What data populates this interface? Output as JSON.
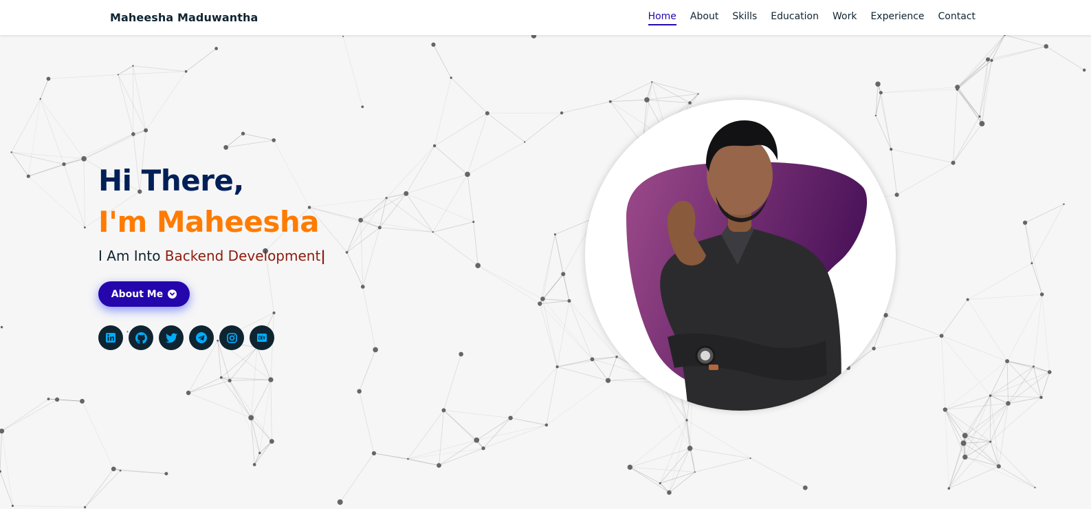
{
  "brand": "Maheesha Maduwantha",
  "nav": [
    {
      "label": "Home",
      "active": true
    },
    {
      "label": "About"
    },
    {
      "label": "Skills"
    },
    {
      "label": "Education"
    },
    {
      "label": "Work"
    },
    {
      "label": "Experience"
    },
    {
      "label": "Contact"
    }
  ],
  "hero": {
    "greeting": "Hi There,",
    "name": "I'm Maheesha",
    "role_prefix": "I Am Into",
    "role_typed": "Backend Development",
    "cursor": "|",
    "button_label": "About Me",
    "button_icon": "chevron-circle-down-icon"
  },
  "socials": [
    {
      "name": "linkedin",
      "icon": "linkedin-icon"
    },
    {
      "name": "github",
      "icon": "github-icon"
    },
    {
      "name": "twitter",
      "icon": "twitter-icon"
    },
    {
      "name": "telegram",
      "icon": "telegram-icon"
    },
    {
      "name": "instagram",
      "icon": "instagram-icon"
    },
    {
      "name": "dev",
      "icon": "dev-icon"
    }
  ],
  "colors": {
    "header_bg": "#ffffff",
    "page_bg": "#f6f6f6",
    "nav_active": "#2506ad",
    "greeting": "#002057",
    "name": "#ff7b00",
    "typed": "#8e1b0d",
    "button_bg": "#2506ad",
    "social_bg": "#0e2431",
    "social_icon": "#00aeff",
    "blob_start": "#9c4a8a",
    "blob_end": "#4a1259"
  }
}
